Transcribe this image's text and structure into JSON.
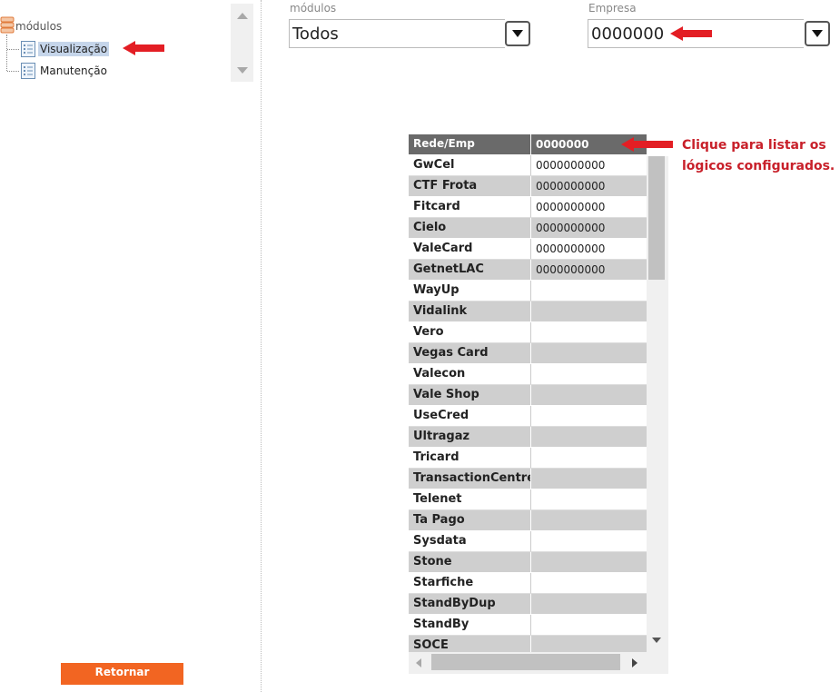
{
  "tree": {
    "root_label": "módulos",
    "items": [
      {
        "label": "Visualização",
        "selected": true
      },
      {
        "label": "Manutenção",
        "selected": false
      }
    ]
  },
  "filters": {
    "modulos": {
      "label": "módulos",
      "value": "Todos"
    },
    "empresa": {
      "label": "Empresa",
      "value": "0000000"
    }
  },
  "grid": {
    "columns": [
      "Rede/Emp",
      "0000000"
    ],
    "rows": [
      [
        "GwCel",
        "0000000000"
      ],
      [
        "CTF Frota",
        "0000000000"
      ],
      [
        "Fitcard",
        "0000000000"
      ],
      [
        "Cielo",
        "0000000000"
      ],
      [
        "ValeCard",
        "0000000000"
      ],
      [
        "GetnetLAC",
        "0000000000"
      ],
      [
        "WayUp",
        ""
      ],
      [
        "Vidalink",
        ""
      ],
      [
        "Vero",
        ""
      ],
      [
        "Vegas Card",
        ""
      ],
      [
        "Valecon",
        ""
      ],
      [
        "Vale Shop",
        ""
      ],
      [
        "UseCred",
        ""
      ],
      [
        "Ultragaz",
        ""
      ],
      [
        "Tricard",
        ""
      ],
      [
        "TransactionCentre",
        ""
      ],
      [
        "Telenet",
        ""
      ],
      [
        "Ta Pago",
        ""
      ],
      [
        "Sysdata",
        ""
      ],
      [
        "Stone",
        ""
      ],
      [
        "Starfiche",
        ""
      ],
      [
        "StandByDup",
        ""
      ],
      [
        "StandBy",
        ""
      ],
      [
        "SOCE",
        ""
      ]
    ]
  },
  "annotation": {
    "line1": "Clique para listar os",
    "line2": "lógicos configurados."
  },
  "return_button": {
    "label": "Retornar"
  },
  "colors": {
    "accent_orange": "#f26522",
    "arrow_red": "#e31e24",
    "annotation_red": "#c8202a",
    "header_gray": "#6a6a6a",
    "row_alt_gray": "#cfcfcf",
    "selection_blue": "#c5d5ea"
  },
  "icons": {
    "tree_root": "database-icon",
    "tree_item": "document-list-icon",
    "dropdown": "dropdown-arrow-icon",
    "annotation_arrow": "red-arrow-icon"
  }
}
